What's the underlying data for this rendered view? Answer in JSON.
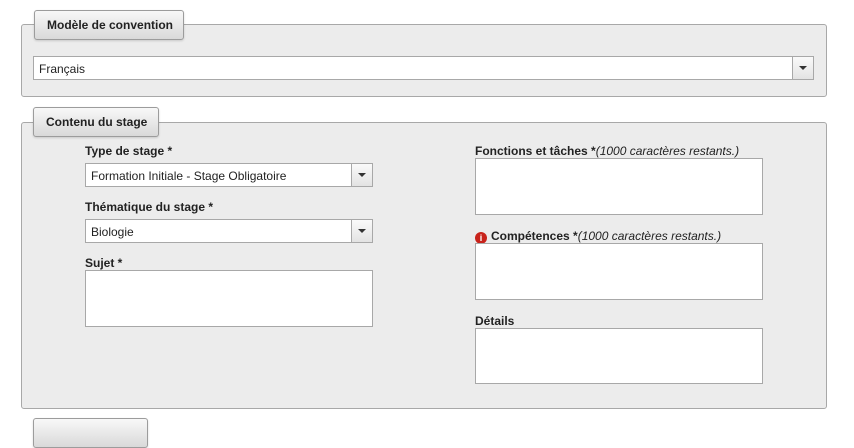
{
  "convention": {
    "legend": "Modèle de convention",
    "language_select": {
      "value": "Français"
    }
  },
  "contenu": {
    "legend": "Contenu du stage",
    "type_stage": {
      "label": "Type de stage *",
      "value": "Formation Initiale - Stage Obligatoire"
    },
    "thematique": {
      "label": "Thématique du stage *",
      "value": "Biologie"
    },
    "sujet": {
      "label": "Sujet *"
    },
    "fonctions": {
      "label": "Fonctions et tâches *",
      "hint": "(1000 caractères restants.)"
    },
    "competences": {
      "label": "Compétences *",
      "hint": "(1000 caractères restants.)",
      "error_icon": "error-icon",
      "error_color": "#c8231b"
    },
    "details": {
      "label": "Détails"
    }
  }
}
